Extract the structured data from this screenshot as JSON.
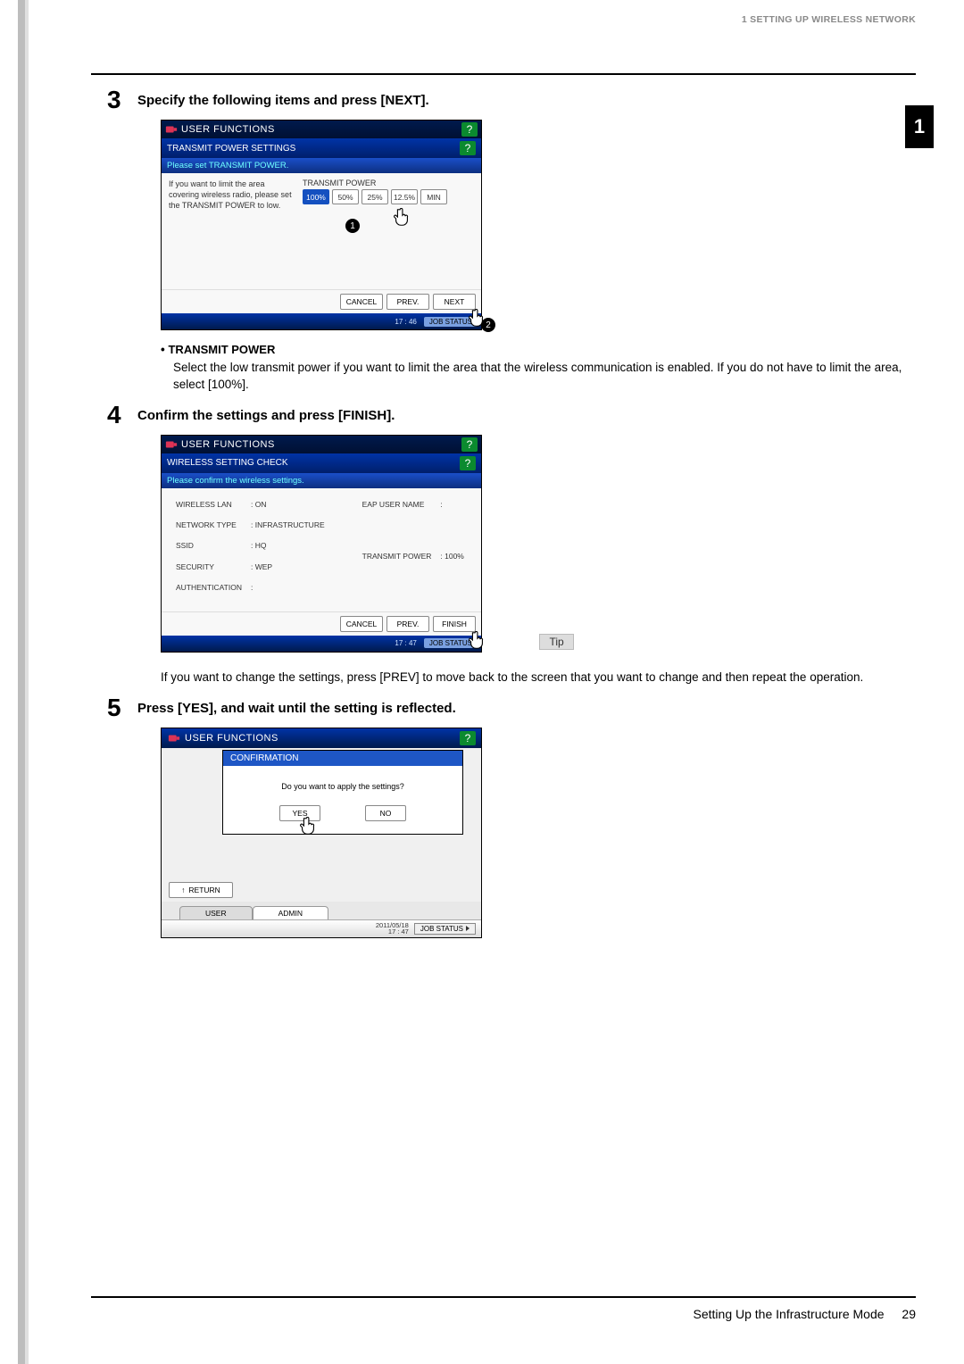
{
  "header": {
    "section": "1 SETTING UP WIRELESS NETWORK"
  },
  "chapter_tab": "1",
  "step3": {
    "number": "3",
    "title": "Specify the following items and press [NEXT].",
    "screenshot": {
      "titlebar": "USER FUNCTIONS",
      "subtitle": "TRANSMIT POWER SETTINGS",
      "instruction": "Please set TRANSMIT POWER.",
      "body_note": "If you want to limit the area covering wireless radio, please set the TRANSMIT POWER to low.",
      "tp_label": "TRANSMIT POWER",
      "tp_options": [
        "100%",
        "50%",
        "25%",
        "12.5%",
        "MIN"
      ],
      "tp_selected": "100%",
      "footer": {
        "cancel": "CANCEL",
        "prev": "PREV.",
        "next": "NEXT"
      },
      "time": "17 : 46",
      "jobstatus": "JOB STATUS",
      "hand_badge": "1",
      "next_badge": "2"
    },
    "bullet": {
      "title": "TRANSMIT POWER",
      "desc": "Select the low transmit power if you want to limit the area that the wireless communication is enabled. If you do not have to limit the area, select [100%]."
    }
  },
  "step4": {
    "number": "4",
    "title": "Confirm the settings and press [FINISH].",
    "screenshot": {
      "titlebar": "USER FUNCTIONS",
      "subtitle": "WIRELESS SETTING CHECK",
      "instruction": "Please confirm the wireless settings.",
      "left_rows": [
        [
          "WIRELESS LAN",
          ": ON"
        ],
        [
          "NETWORK TYPE",
          ": INFRASTRUCTURE"
        ],
        [
          "SSID",
          ": HQ"
        ],
        [
          "SECURITY",
          ": WEP"
        ],
        [
          "AUTHENTICATION",
          ":"
        ]
      ],
      "right_rows": [
        [
          "EAP USER NAME",
          ":"
        ],
        [
          "TRANSMIT POWER",
          ": 100%"
        ]
      ],
      "footer": {
        "cancel": "CANCEL",
        "prev": "PREV.",
        "finish": "FINISH"
      },
      "time": "17 : 47",
      "jobstatus": "JOB STATUS"
    },
    "tip_label": "Tip",
    "tip_text": "If you want to change the settings, press [PREV] to move back to the screen that you want to change and then repeat the operation."
  },
  "step5": {
    "number": "5",
    "title": "Press [YES], and wait until the setting is reflected.",
    "screenshot": {
      "titlebar": "USER FUNCTIONS",
      "dialog_title": "CONFIRMATION",
      "dialog_msg": "Do you want to apply the settings?",
      "yes": "YES",
      "no": "NO",
      "return": "RETURN",
      "tabs": {
        "user": "USER",
        "admin": "ADMIN"
      },
      "datetime": "2011/05/18\n17 : 47",
      "jobstatus": "JOB STATUS"
    }
  },
  "footer": {
    "text": "Setting Up the Infrastructure Mode",
    "pagenum": "29"
  }
}
